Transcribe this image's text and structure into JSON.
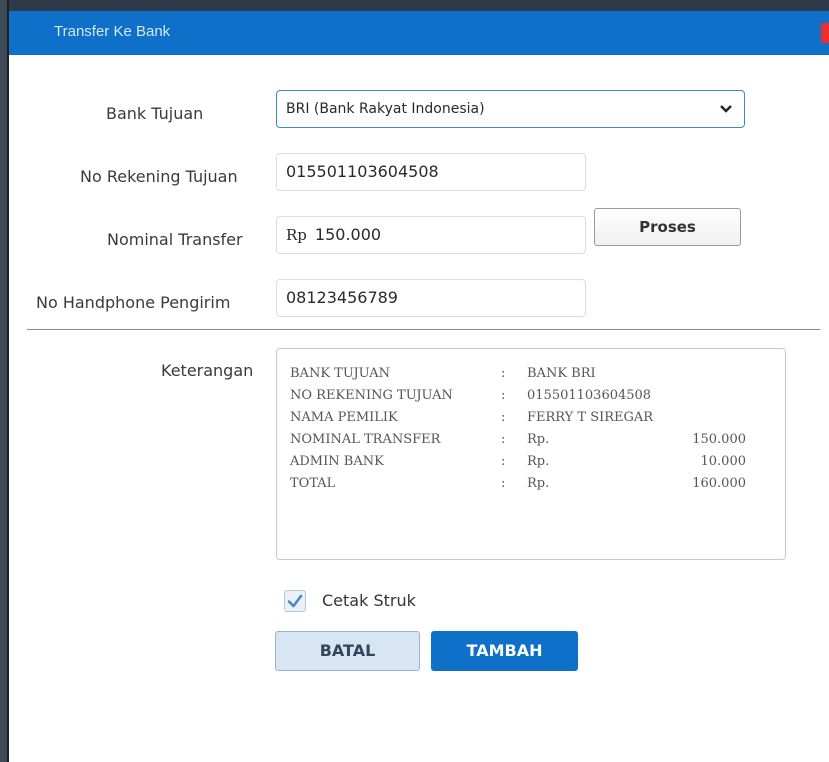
{
  "window": {
    "title": "Transfer Ke Bank"
  },
  "form": {
    "bank_tujuan": {
      "label": "Bank Tujuan",
      "value": "BRI (Bank Rakyat Indonesia)"
    },
    "no_rekening": {
      "label": "No Rekening Tujuan",
      "value": "015501103604508"
    },
    "nominal": {
      "label": "Nominal Transfer",
      "currency": "Rp",
      "value": "150.000"
    },
    "no_hp": {
      "label": "No Handphone Pengirim",
      "value": "08123456789"
    },
    "proses_label": "Proses"
  },
  "keterangan": {
    "label": "Keterangan",
    "lines": [
      {
        "key": "BANK TUJUAN",
        "colon": ":",
        "value": "BANK BRI",
        "amount": ""
      },
      {
        "key": "NO REKENING TUJUAN",
        "colon": ":",
        "value": "015501103604508",
        "amount": ""
      },
      {
        "key": "NAMA PEMILIK",
        "colon": ":",
        "value": "FERRY T SIREGAR",
        "amount": ""
      },
      {
        "key": "NOMINAL TRANSFER",
        "colon": ":",
        "value": "Rp.",
        "amount": "150.000"
      },
      {
        "key": "ADMIN BANK",
        "colon": ":",
        "value": "Rp.",
        "amount": "10.000"
      },
      {
        "key": "TOTAL",
        "colon": ":",
        "value": "Rp.",
        "amount": "160.000"
      }
    ]
  },
  "cetak_struk": {
    "label": "Cetak Struk",
    "checked": true
  },
  "actions": {
    "batal": "BATAL",
    "tambah": "TAMBAH"
  },
  "colors": {
    "accent": "#0e70c8",
    "close": "#e8312f"
  }
}
